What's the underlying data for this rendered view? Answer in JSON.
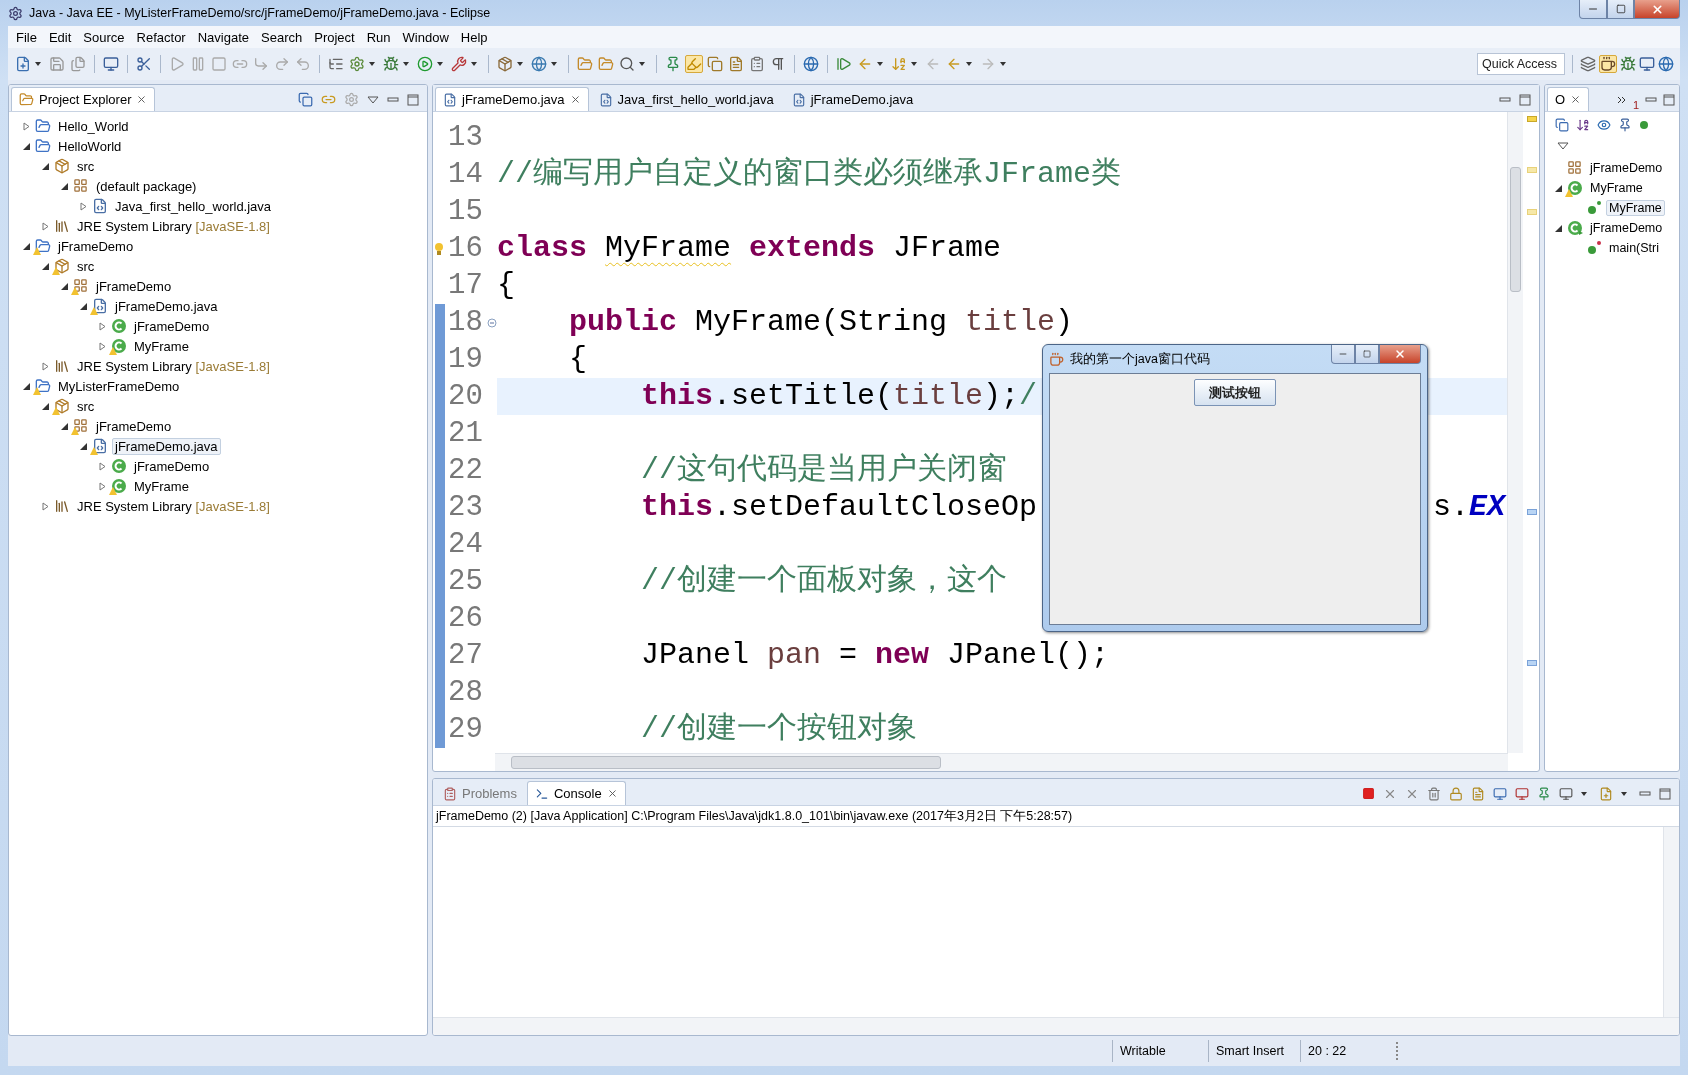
{
  "window": {
    "title": "Java - Java EE - MyListerFrameDemo/src/jFrameDemo/jFrameDemo.java - Eclipse"
  },
  "menu": [
    "File",
    "Edit",
    "Source",
    "Refactor",
    "Navigate",
    "Search",
    "Project",
    "Run",
    "Window",
    "Help"
  ],
  "quick_access": {
    "placeholder": "Quick Access"
  },
  "project_explorer": {
    "title": "Project Explorer",
    "tree": [
      {
        "label": "Hello_World",
        "kind": "project",
        "expanded": false,
        "warning": false,
        "selected": false
      },
      {
        "label": "HelloWorld",
        "kind": "project",
        "expanded": true,
        "warning": false,
        "selected": false,
        "children": [
          {
            "label": "src",
            "kind": "source-folder",
            "expanded": true,
            "warning": false,
            "selected": false,
            "children": [
              {
                "label": "(default package)",
                "kind": "package",
                "expanded": true,
                "warning": false,
                "selected": false,
                "children": [
                  {
                    "label": "Java_first_hello_world.java",
                    "kind": "java-file",
                    "expanded": false,
                    "warning": false,
                    "selected": false
                  }
                ]
              }
            ]
          },
          {
            "label": "JRE System Library",
            "decoration": "[JavaSE-1.8]",
            "kind": "library",
            "expanded": false,
            "warning": false,
            "selected": false
          }
        ]
      },
      {
        "label": "jFrameDemo",
        "kind": "project",
        "expanded": true,
        "warning": true,
        "selected": false,
        "children": [
          {
            "label": "src",
            "kind": "source-folder",
            "expanded": true,
            "warning": true,
            "selected": false,
            "children": [
              {
                "label": "jFrameDemo",
                "kind": "package",
                "expanded": true,
                "warning": true,
                "selected": false,
                "children": [
                  {
                    "label": "jFrameDemo.java",
                    "kind": "java-file",
                    "expanded": true,
                    "warning": true,
                    "selected": false,
                    "children": [
                      {
                        "label": "jFrameDemo",
                        "kind": "class",
                        "expanded": false,
                        "warning": false,
                        "selected": false
                      },
                      {
                        "label": "MyFrame",
                        "kind": "class",
                        "expanded": false,
                        "warning": true,
                        "selected": false
                      }
                    ]
                  }
                ]
              }
            ]
          },
          {
            "label": "JRE System Library",
            "decoration": "[JavaSE-1.8]",
            "kind": "library",
            "expanded": false,
            "warning": false,
            "selected": false
          }
        ]
      },
      {
        "label": "MyListerFrameDemo",
        "kind": "project",
        "expanded": true,
        "warning": true,
        "selected": false,
        "children": [
          {
            "label": "src",
            "kind": "source-folder",
            "expanded": true,
            "warning": true,
            "selected": false,
            "children": [
              {
                "label": "jFrameDemo",
                "kind": "package",
                "expanded": true,
                "warning": true,
                "selected": false,
                "children": [
                  {
                    "label": "jFrameDemo.java",
                    "kind": "java-file",
                    "expanded": true,
                    "warning": true,
                    "selected": true,
                    "children": [
                      {
                        "label": "jFrameDemo",
                        "kind": "class",
                        "expanded": false,
                        "warning": false,
                        "selected": false
                      },
                      {
                        "label": "MyFrame",
                        "kind": "class",
                        "expanded": false,
                        "warning": true,
                        "selected": false
                      }
                    ]
                  }
                ]
              }
            ]
          },
          {
            "label": "JRE System Library",
            "decoration": "[JavaSE-1.8]",
            "kind": "library",
            "expanded": false,
            "warning": false,
            "selected": false
          }
        ]
      }
    ]
  },
  "editor": {
    "tabs": [
      {
        "label": "jFrameDemo.java",
        "selected": true
      },
      {
        "label": "Java_first_hello_world.java",
        "selected": false
      },
      {
        "label": "jFrameDemo.java",
        "selected": false
      }
    ],
    "lines": [
      {
        "number": "13",
        "current": false,
        "range": false,
        "warning": false,
        "foldable": false
      },
      {
        "number": "14",
        "current": false,
        "range": false,
        "warning": false,
        "foldable": false,
        "tokens": [
          {
            "text": "//编写用户自定义的窗口类必须继承JFrame类",
            "kind": "comment"
          }
        ]
      },
      {
        "number": "15",
        "current": false,
        "range": false,
        "warning": false,
        "foldable": false
      },
      {
        "number": "16",
        "current": false,
        "range": false,
        "warning": true,
        "foldable": false,
        "tokens": [
          {
            "text": "class ",
            "kind": "keyword"
          },
          {
            "text": "MyFrame",
            "kind": "warned"
          },
          {
            "text": " extends",
            "kind": "keyword"
          },
          {
            "text": " JFrame",
            "kind": "plain"
          }
        ]
      },
      {
        "number": "17",
        "current": false,
        "range": false,
        "warning": false,
        "foldable": false,
        "tokens": [
          {
            "text": "{",
            "kind": "plain"
          }
        ]
      },
      {
        "number": "18",
        "current": false,
        "range": true,
        "warning": false,
        "foldable": true,
        "tokens": [
          {
            "text": "    public",
            "kind": "keyword"
          },
          {
            "text": " MyFrame(String ",
            "kind": "plain"
          },
          {
            "text": "title",
            "kind": "variable"
          },
          {
            "text": ")",
            "kind": "plain"
          }
        ]
      },
      {
        "number": "19",
        "current": false,
        "range": true,
        "warning": false,
        "foldable": false,
        "tokens": [
          {
            "text": "    {",
            "kind": "plain"
          }
        ]
      },
      {
        "number": "20",
        "current": true,
        "range": true,
        "warning": false,
        "foldable": false,
        "tokens": [
          {
            "text": "        this",
            "kind": "keyword"
          },
          {
            "text": ".setTitle(",
            "kind": "plain"
          },
          {
            "text": "title",
            "kind": "variable"
          },
          {
            "text": ");",
            "kind": "plain"
          },
          {
            "text": "/",
            "kind": "comment"
          }
        ]
      },
      {
        "number": "21",
        "current": false,
        "range": true,
        "warning": false,
        "foldable": false
      },
      {
        "number": "22",
        "current": false,
        "range": true,
        "warning": false,
        "foldable": false,
        "tokens": [
          {
            "text": "        //这句代码是当用户关闭窗",
            "kind": "comment"
          }
        ]
      },
      {
        "number": "23",
        "current": false,
        "range": true,
        "warning": false,
        "foldable": false,
        "tokens": [
          {
            "text": "        this",
            "kind": "keyword"
          },
          {
            "text": ".setDefaultCloseOp",
            "kind": "plain"
          }
        ],
        "after_overlay": [
          {
            "text": "s.",
            "kind": "plain"
          },
          {
            "text": "EX",
            "kind": "constant"
          }
        ]
      },
      {
        "number": "24",
        "current": false,
        "range": true,
        "warning": false,
        "foldable": false
      },
      {
        "number": "25",
        "current": false,
        "range": true,
        "warning": false,
        "foldable": false,
        "tokens": [
          {
            "text": "        //创建一个面板对象，这个",
            "kind": "comment"
          }
        ]
      },
      {
        "number": "26",
        "current": false,
        "range": true,
        "warning": false,
        "foldable": false
      },
      {
        "number": "27",
        "current": false,
        "range": true,
        "warning": false,
        "foldable": false,
        "tokens": [
          {
            "text": "        JPanel ",
            "kind": "plain"
          },
          {
            "text": "pan",
            "kind": "variable"
          },
          {
            "text": " = ",
            "kind": "plain"
          },
          {
            "text": "new",
            "kind": "keyword"
          },
          {
            "text": " JPanel();",
            "kind": "plain"
          }
        ]
      },
      {
        "number": "28",
        "current": false,
        "range": true,
        "warning": false,
        "foldable": false
      },
      {
        "number": "29",
        "current": false,
        "range": true,
        "warning": false,
        "foldable": false,
        "tokens": [
          {
            "text": "        //创建一个按钮对象",
            "kind": "comment"
          }
        ]
      }
    ]
  },
  "dialog": {
    "title": "我的第一个java窗口代码",
    "button": "测试按钮"
  },
  "outline": {
    "tab": "O",
    "overflow": "1",
    "tree": [
      {
        "label": "jFrameDemo",
        "kind": "package",
        "warning": false,
        "selected": false
      },
      {
        "label": "MyFrame",
        "kind": "class",
        "expanded": true,
        "warning": true,
        "selected": false,
        "children": [
          {
            "label": "MyFrame",
            "kind": "constructor",
            "warning": false,
            "selected": true
          }
        ]
      },
      {
        "label": "jFrameDemo",
        "kind": "main-class",
        "expanded": true,
        "warning": false,
        "selected": false,
        "children": [
          {
            "label": "main(Stri",
            "kind": "static-method",
            "warning": false,
            "selected": false
          }
        ]
      }
    ]
  },
  "console": {
    "tabs": [
      {
        "label": "Problems",
        "selected": false
      },
      {
        "label": "Console",
        "selected": true
      }
    ],
    "header": "jFrameDemo (2) [Java Application] C:\\Program Files\\Java\\jdk1.8.0_101\\bin\\javaw.exe (2017年3月2日 下午5:28:57)"
  },
  "status_bar": [
    "Writable",
    "Smart Insert",
    "20 : 22"
  ]
}
